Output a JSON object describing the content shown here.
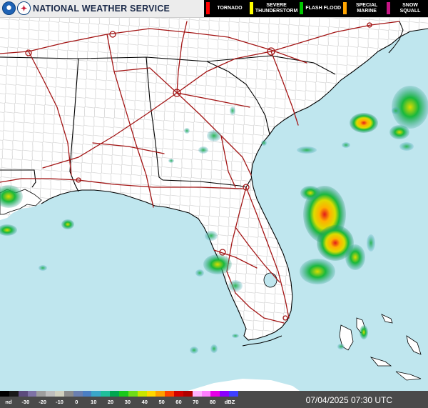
{
  "header": {
    "title": "NATIONAL WEATHER SERVICE",
    "legend": [
      {
        "label": "TORNADO",
        "color": "#ff0000"
      },
      {
        "label": "SEVERE THUNDERSTORM",
        "color": "#ffff00"
      },
      {
        "label": "FLASH FLOOD",
        "color": "#00c800"
      },
      {
        "label": "SPECIAL MARINE",
        "color": "#ffa500"
      },
      {
        "label": "SNOW SQUALL",
        "color": "#c71585"
      }
    ]
  },
  "footer": {
    "dbz_colors": [
      "#000000",
      "#1a1a1a",
      "#5c4b7d",
      "#7e72a6",
      "#9e9e9e",
      "#bdbdbd",
      "#d0d0bf",
      "#8c8c8c",
      "#6a7fb0",
      "#4a7fc4",
      "#3aa6c9",
      "#1fbf9a",
      "#00a650",
      "#19c81c",
      "#6edc19",
      "#c8e600",
      "#ffd800",
      "#ffa000",
      "#ff4400",
      "#d20000",
      "#b00000",
      "#ffb3ff",
      "#ff7fff",
      "#e600e6",
      "#8b00ff",
      "#3f3fff"
    ],
    "dbz_labels": [
      "nd",
      "-30",
      "-20",
      "-10",
      "0",
      "10",
      "20",
      "30",
      "40",
      "50",
      "60",
      "70",
      "80",
      "dBZ"
    ],
    "timestamp": "07/04/2025 07:30 UTC"
  },
  "map": {
    "ocean_color": "#bfe6ee",
    "land_color": "#ffffff",
    "county_line_color": "#b8b8b8",
    "state_line_color": "#000000",
    "highway_color": "#a31515",
    "radar_echo_colors": [
      "#1f8c6d",
      "#19b83c",
      "#6fdc2a",
      "#dcdc00",
      "#ff9900",
      "#e31a1a"
    ]
  }
}
